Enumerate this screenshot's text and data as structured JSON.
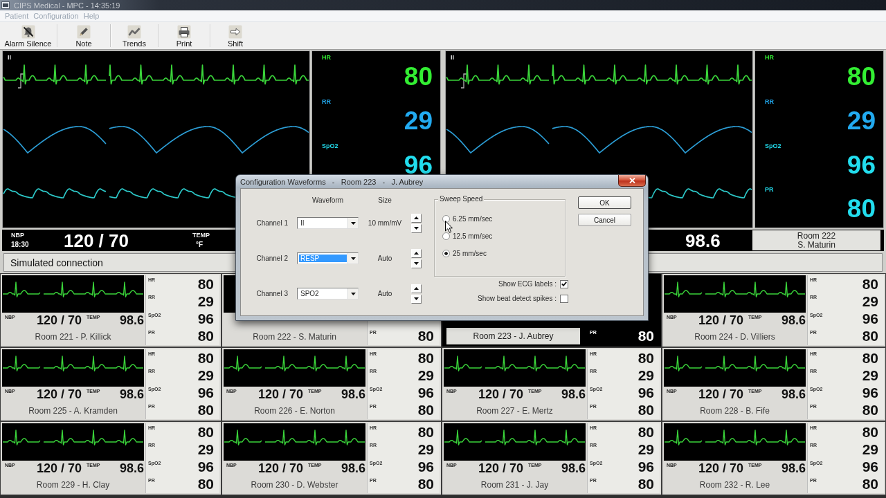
{
  "window": {
    "title": "CIPS Medical - MPC - 14:35:19"
  },
  "menu": [
    {
      "label": "Patient",
      "disabled": true
    },
    {
      "label": "Configuration",
      "disabled": true
    },
    {
      "label": "Help",
      "disabled": true
    }
  ],
  "toolbar": [
    {
      "label": "Alarm Silence"
    },
    {
      "label": "Note"
    },
    {
      "label": "Trends"
    },
    {
      "label": "Print"
    },
    {
      "label": "Shift"
    }
  ],
  "monitors": [
    {
      "lead_label": "II",
      "waveforms": [
        {
          "kind": "ecg",
          "color": "#3ad43a"
        },
        {
          "kind": "resp",
          "color": "#2c9ed6"
        },
        {
          "kind": "pleth",
          "color": "#2cc8c8"
        }
      ],
      "vitals": {
        "hr": {
          "label": "HR",
          "value": "80",
          "color": "#33ee33"
        },
        "rr": {
          "label": "RR",
          "value": "29",
          "color": "#22aaf0"
        },
        "spo2": {
          "label": "SpO2",
          "value": "96",
          "color": "#22ddee"
        }
      },
      "nbp": {
        "label": "NBP",
        "time": "18:30",
        "value": "120 / 70"
      },
      "temp": {
        "label": "TEMP",
        "unit": "°F"
      },
      "status": "Simulated connection"
    },
    {
      "lead_label": "II",
      "waveforms": [
        {
          "kind": "ecg",
          "color": "#3ad43a"
        },
        {
          "kind": "resp",
          "color": "#2c9ed6"
        },
        {
          "kind": "pleth",
          "color": "#2cc8c8"
        }
      ],
      "vitals": {
        "hr": {
          "label": "HR",
          "value": "80",
          "color": "#33ee33"
        },
        "rr": {
          "label": "RR",
          "value": "29",
          "color": "#22aaf0"
        },
        "spo2": {
          "label": "SpO2",
          "value": "96",
          "color": "#22ddee"
        },
        "pr": {
          "label": "PR",
          "value": "80",
          "color": "#22ddee"
        }
      },
      "temp": {
        "value": "98.6"
      },
      "room": "Room 222\nS. Maturin"
    }
  ],
  "tiles": [
    {
      "room": "Room 221 - P. Killick",
      "selected": false,
      "waveform": {
        "kind": "ecg"
      },
      "nbp": {
        "label": "NBP",
        "value": "120 / 70"
      },
      "temp": {
        "label": "TEMP",
        "value": "98.6"
      },
      "vitals": {
        "hr": {
          "label": "HR",
          "value": "80"
        },
        "rr": {
          "label": "RR",
          "value": "29"
        },
        "spo2": {
          "label": "SpO2",
          "value": "96"
        },
        "pr": {
          "label": "PR",
          "value": "80"
        }
      }
    },
    {
      "room": "Room 222 - S. Maturin",
      "selected": false,
      "vitals": {
        "pr": {
          "label": "PR",
          "value": "80"
        }
      }
    },
    {
      "room": "Room 223 - J. Aubrey",
      "selected": true,
      "vitals": {
        "pr": {
          "label": "PR",
          "value": "80"
        }
      }
    },
    {
      "room": "Room 224 - D. Villiers",
      "selected": false,
      "waveform": {
        "kind": "ecg"
      },
      "nbp": {
        "label": "NBP",
        "value": "120 / 70"
      },
      "temp": {
        "label": "TEMP",
        "value": "98.6"
      },
      "vitals": {
        "hr": {
          "label": "HR",
          "value": "80"
        },
        "rr": {
          "label": "RR",
          "value": "29"
        },
        "spo2": {
          "label": "SpO2",
          "value": "96"
        },
        "pr": {
          "label": "PR",
          "value": "80"
        }
      }
    },
    {
      "room": "Room 225 - A. Kramden",
      "selected": false,
      "waveform": {
        "kind": "ecg"
      },
      "nbp": {
        "label": "NBP",
        "value": "120 / 70"
      },
      "temp": {
        "label": "TEMP",
        "value": "98.6"
      },
      "vitals": {
        "hr": {
          "label": "HR",
          "value": "80"
        },
        "rr": {
          "label": "RR",
          "value": "29"
        },
        "spo2": {
          "label": "SpO2",
          "value": "96"
        },
        "pr": {
          "label": "PR",
          "value": "80"
        }
      }
    },
    {
      "room": "Room 226 - E. Norton",
      "selected": false,
      "waveform": {
        "kind": "ecg"
      },
      "nbp": {
        "label": "NBP",
        "value": "120 / 70"
      },
      "temp": {
        "label": "TEMP",
        "value": "98.6"
      },
      "vitals": {
        "hr": {
          "label": "HR",
          "value": "80"
        },
        "rr": {
          "label": "RR",
          "value": "29"
        },
        "spo2": {
          "label": "SpO2",
          "value": "96"
        },
        "pr": {
          "label": "PR",
          "value": "80"
        }
      }
    },
    {
      "room": "Room 227 - E. Mertz",
      "selected": false,
      "waveform": {
        "kind": "ecg"
      },
      "nbp": {
        "label": "NBP",
        "value": "120 / 70"
      },
      "temp": {
        "label": "TEMP",
        "value": "98.6"
      },
      "vitals": {
        "hr": {
          "label": "HR",
          "value": "80"
        },
        "rr": {
          "label": "RR",
          "value": "29"
        },
        "spo2": {
          "label": "SpO2",
          "value": "96"
        },
        "pr": {
          "label": "PR",
          "value": "80"
        }
      }
    },
    {
      "room": "Room 228 - B. Fife",
      "selected": false,
      "waveform": {
        "kind": "ecg"
      },
      "nbp": {
        "label": "NBP",
        "value": "120 / 70"
      },
      "temp": {
        "label": "TEMP",
        "value": "98.6"
      },
      "vitals": {
        "hr": {
          "label": "HR",
          "value": "80"
        },
        "rr": {
          "label": "RR",
          "value": "29"
        },
        "spo2": {
          "label": "SpO2",
          "value": "96"
        },
        "pr": {
          "label": "PR",
          "value": "80"
        }
      }
    },
    {
      "room": "Room 229 - H. Clay",
      "selected": false,
      "waveform": {
        "kind": "ecg"
      },
      "nbp": {
        "label": "NBP",
        "value": "120 / 70"
      },
      "temp": {
        "label": "TEMP",
        "value": "98.6"
      },
      "vitals": {
        "hr": {
          "label": "HR",
          "value": "80"
        },
        "rr": {
          "label": "RR",
          "value": "29"
        },
        "spo2": {
          "label": "SpO2",
          "value": "96"
        },
        "pr": {
          "label": "PR",
          "value": "80"
        }
      }
    },
    {
      "room": "Room 230 - D. Webster",
      "selected": false,
      "waveform": {
        "kind": "ecg"
      },
      "nbp": {
        "label": "NBP",
        "value": "120 / 70"
      },
      "temp": {
        "label": "TEMP",
        "value": "98.6"
      },
      "vitals": {
        "hr": {
          "label": "HR",
          "value": "80"
        },
        "rr": {
          "label": "RR",
          "value": "29"
        },
        "spo2": {
          "label": "SpO2",
          "value": "96"
        },
        "pr": {
          "label": "PR",
          "value": "80"
        }
      }
    },
    {
      "room": "Room 231 - J. Jay",
      "selected": false,
      "waveform": {
        "kind": "ecg"
      },
      "nbp": {
        "label": "NBP",
        "value": "120 / 70"
      },
      "temp": {
        "label": "TEMP",
        "value": "98.6"
      },
      "vitals": {
        "hr": {
          "label": "HR",
          "value": "80"
        },
        "rr": {
          "label": "RR",
          "value": "29"
        },
        "spo2": {
          "label": "SpO2",
          "value": "96"
        },
        "pr": {
          "label": "PR",
          "value": "80"
        }
      }
    },
    {
      "room": "Room 232 - R. Lee",
      "selected": false,
      "waveform": {
        "kind": "ecg"
      },
      "nbp": {
        "label": "NBP",
        "value": "120 / 70"
      },
      "temp": {
        "label": "TEMP",
        "value": "98.6"
      },
      "vitals": {
        "hr": {
          "label": "HR",
          "value": "80"
        },
        "rr": {
          "label": "RR",
          "value": "29"
        },
        "spo2": {
          "label": "SpO2",
          "value": "96"
        },
        "pr": {
          "label": "PR",
          "value": "80"
        }
      }
    }
  ],
  "dialog": {
    "title": "Configuration Waveforms   -   Room 223   -   J. Aubrey",
    "headers": {
      "waveform": "Waveform",
      "size": "Size"
    },
    "channels": [
      {
        "label": "Channel 1",
        "waveform": "II",
        "size": "10 mm/mV",
        "highlighted": false
      },
      {
        "label": "Channel 2",
        "waveform": "RESP",
        "size": "Auto",
        "highlighted": true
      },
      {
        "label": "Channel 3",
        "waveform": "SPO2",
        "size": "Auto",
        "highlighted": false
      }
    ],
    "sweep": {
      "title": "Sweep Speed",
      "options": [
        {
          "label": "6.25 mm/sec",
          "selected": false
        },
        {
          "label": "12.5 mm/sec",
          "selected": false
        },
        {
          "label": "25 mm/sec",
          "selected": true
        }
      ]
    },
    "options": [
      {
        "label": "Show ECG labels :",
        "checked": true
      },
      {
        "label": "Show beat detect spikes :",
        "checked": false
      }
    ],
    "buttons": [
      "OK",
      "Cancel"
    ]
  }
}
